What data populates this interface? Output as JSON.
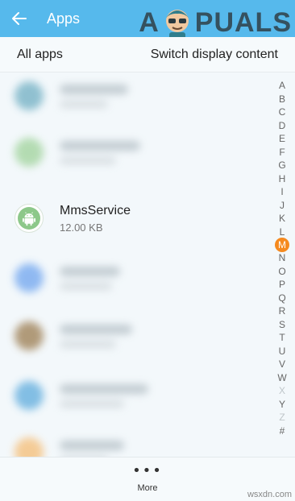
{
  "header": {
    "title": "Apps",
    "back_icon": "arrow-left-icon",
    "bg": "#56b9ec"
  },
  "watermark": {
    "pre": "A",
    "post": "PUALS"
  },
  "subbar": {
    "left_label": "All apps",
    "right_label": "Switch display content"
  },
  "app": {
    "name": "MmsService",
    "size": "12.00 KB",
    "icon": "android-icon"
  },
  "blurred_icon_colors": [
    "#7fb7c9",
    "#a9d7a6",
    "#7eaef0",
    "#a58a63",
    "#6fb4e0",
    "#f5c485"
  ],
  "index": {
    "letters": [
      "A",
      "B",
      "C",
      "D",
      "E",
      "F",
      "G",
      "H",
      "I",
      "J",
      "K",
      "L",
      "M",
      "N",
      "O",
      "P",
      "Q",
      "R",
      "S",
      "T",
      "U",
      "V",
      "W",
      "X",
      "Y",
      "Z",
      "#"
    ],
    "active": "M",
    "dimmed": [
      "X",
      "Z"
    ],
    "active_color": "#f58a1f"
  },
  "bottom": {
    "more_label": "More",
    "more_icon": "more-dots-icon"
  },
  "footer_watermark": "wsxdn.com"
}
